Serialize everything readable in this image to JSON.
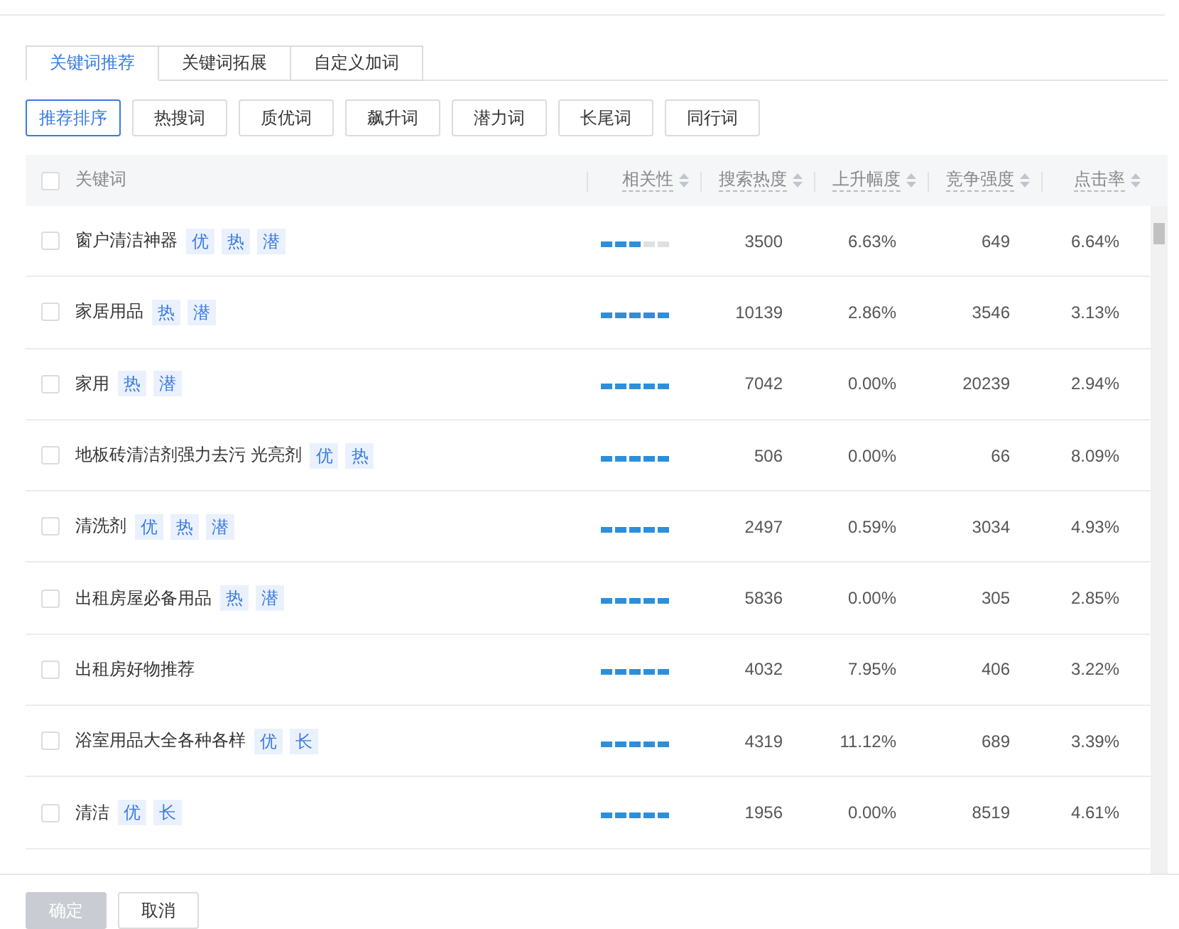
{
  "tabs": [
    {
      "label": "关键词推荐",
      "selected": true
    },
    {
      "label": "关键词拓展",
      "selected": false
    },
    {
      "label": "自定义加词",
      "selected": false
    }
  ],
  "filters": [
    {
      "label": "推荐排序",
      "selected": true
    },
    {
      "label": "热搜词",
      "selected": false
    },
    {
      "label": "质优词",
      "selected": false
    },
    {
      "label": "飙升词",
      "selected": false
    },
    {
      "label": "潜力词",
      "selected": false
    },
    {
      "label": "长尾词",
      "selected": false
    },
    {
      "label": "同行词",
      "selected": false
    }
  ],
  "table": {
    "select_all_checked": false,
    "columns": [
      {
        "label": "关键词",
        "sortable": false
      },
      {
        "label": "相关性",
        "sortable": true
      },
      {
        "label": "搜索热度",
        "sortable": true
      },
      {
        "label": "上升幅度",
        "sortable": true
      },
      {
        "label": "竞争强度",
        "sortable": true
      },
      {
        "label": "点击率",
        "sortable": true
      }
    ],
    "rows": [
      {
        "checked": false,
        "keyword": "窗户清洁神器",
        "tags": [
          "优",
          "热",
          "潜"
        ],
        "stars": 3,
        "search_heat": "3500",
        "rise": "6.63%",
        "competition": "649",
        "ctr": "6.64%"
      },
      {
        "checked": false,
        "keyword": "家居用品",
        "tags": [
          "热",
          "潜"
        ],
        "stars": 5,
        "search_heat": "10139",
        "rise": "2.86%",
        "competition": "3546",
        "ctr": "3.13%"
      },
      {
        "checked": false,
        "keyword": "家用",
        "tags": [
          "热",
          "潜"
        ],
        "stars": 5,
        "search_heat": "7042",
        "rise": "0.00%",
        "competition": "20239",
        "ctr": "2.94%"
      },
      {
        "checked": false,
        "keyword": "地板砖清洁剂强力去污 光亮剂",
        "tags": [
          "优",
          "热"
        ],
        "stars": 5,
        "search_heat": "506",
        "rise": "0.00%",
        "competition": "66",
        "ctr": "8.09%"
      },
      {
        "checked": false,
        "keyword": "清洗剂",
        "tags": [
          "优",
          "热",
          "潜"
        ],
        "stars": 5,
        "search_heat": "2497",
        "rise": "0.59%",
        "competition": "3034",
        "ctr": "4.93%"
      },
      {
        "checked": false,
        "keyword": "出租房屋必备用品",
        "tags": [
          "热",
          "潜"
        ],
        "stars": 5,
        "search_heat": "5836",
        "rise": "0.00%",
        "competition": "305",
        "ctr": "2.85%"
      },
      {
        "checked": false,
        "keyword": "出租房好物推荐",
        "tags": [],
        "stars": 5,
        "search_heat": "4032",
        "rise": "7.95%",
        "competition": "406",
        "ctr": "3.22%"
      },
      {
        "checked": false,
        "keyword": "浴室用品大全各种各样",
        "tags": [
          "优",
          "长"
        ],
        "stars": 5,
        "search_heat": "4319",
        "rise": "11.12%",
        "competition": "689",
        "ctr": "3.39%"
      },
      {
        "checked": false,
        "keyword": "清洁",
        "tags": [
          "优",
          "长"
        ],
        "stars": 5,
        "search_heat": "1956",
        "rise": "0.00%",
        "competition": "8519",
        "ctr": "4.61%"
      }
    ]
  },
  "footer_buttons": [
    {
      "label": "确定",
      "disabled": true
    },
    {
      "label": "取消",
      "disabled": false
    }
  ]
}
